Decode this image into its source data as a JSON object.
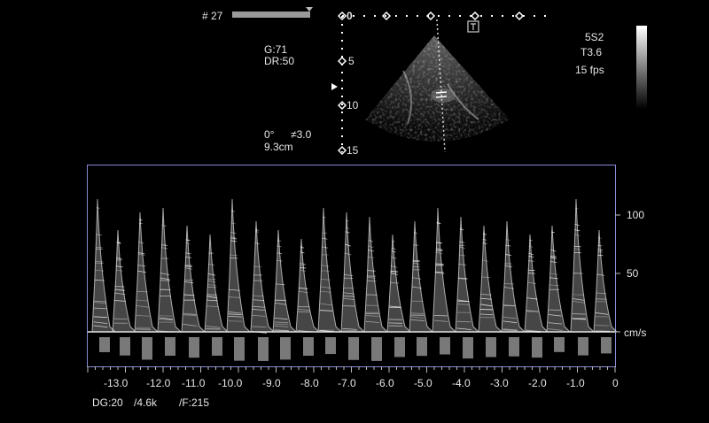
{
  "header": {
    "frame_label": "# 27"
  },
  "image_params": {
    "gain": "G:71",
    "dynamic_range": "DR:50",
    "angle": "0°",
    "angle_marker": "≠3.0",
    "depth": "9.3cm"
  },
  "probe": {
    "model": "5S2",
    "setting": "T3.6",
    "frame_rate": "15 fps"
  },
  "depth_scale": {
    "labels": [
      "0",
      "5",
      "10",
      "15"
    ]
  },
  "velocity_scale": {
    "labels": [
      "100",
      "50"
    ],
    "unit": "cm/s"
  },
  "time_axis": {
    "labels": [
      "-13.0",
      "-12.0",
      "-11.0",
      "-10.0",
      "-9.0",
      "-8.0",
      "-7.0",
      "-6.0",
      "-5.0",
      "-4.0",
      "-3.0",
      "-2.0",
      "-1.0",
      "0"
    ]
  },
  "footer": {
    "doppler_gain": "DG:20",
    "prf": "/4.6k",
    "filter": "/F:215"
  },
  "colors": {
    "panel_border": "#8a8ad8",
    "text": "#e6e6e6",
    "background": "#000000"
  }
}
